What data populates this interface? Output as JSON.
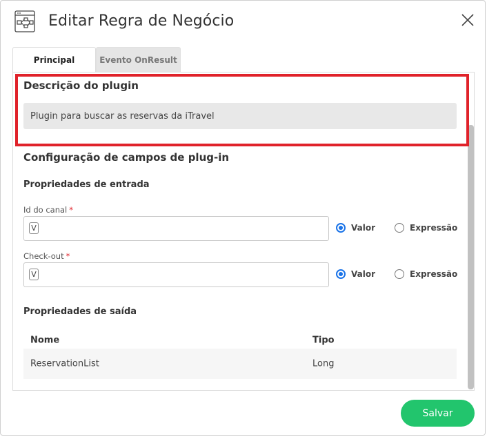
{
  "dialog": {
    "title": "Editar Regra de Negócio",
    "icon": "flow-diagram-icon",
    "close_icon": "close-icon"
  },
  "tabs": [
    {
      "label": "Principal",
      "active": true
    },
    {
      "label": "Evento OnResult",
      "active": false
    }
  ],
  "description": {
    "heading": "Descrição do plugin",
    "value": "Plugin para buscar as reservas da iTravel"
  },
  "config": {
    "heading": "Configuração de campos de plug-in",
    "input_props_heading": "Propriedades de entrada",
    "fields": [
      {
        "label": "Id do canal",
        "required_mark": "*",
        "badge": "V",
        "value": "",
        "options": [
          "Valor",
          "Expressão"
        ],
        "selected": "Valor"
      },
      {
        "label": "Check-out",
        "required_mark": "*",
        "badge": "V",
        "value": "",
        "options": [
          "Valor",
          "Expressão"
        ],
        "selected": "Valor"
      }
    ],
    "output_props_heading": "Propriedades de saída",
    "table": {
      "columns": [
        "Nome",
        "Tipo"
      ],
      "rows": [
        [
          "ReservationList",
          "Long"
        ]
      ]
    }
  },
  "footer": {
    "save_label": "Salvar"
  },
  "colors": {
    "highlight": "#e0222a",
    "save": "#22c56d",
    "radio_checked": "#1a73e8"
  }
}
